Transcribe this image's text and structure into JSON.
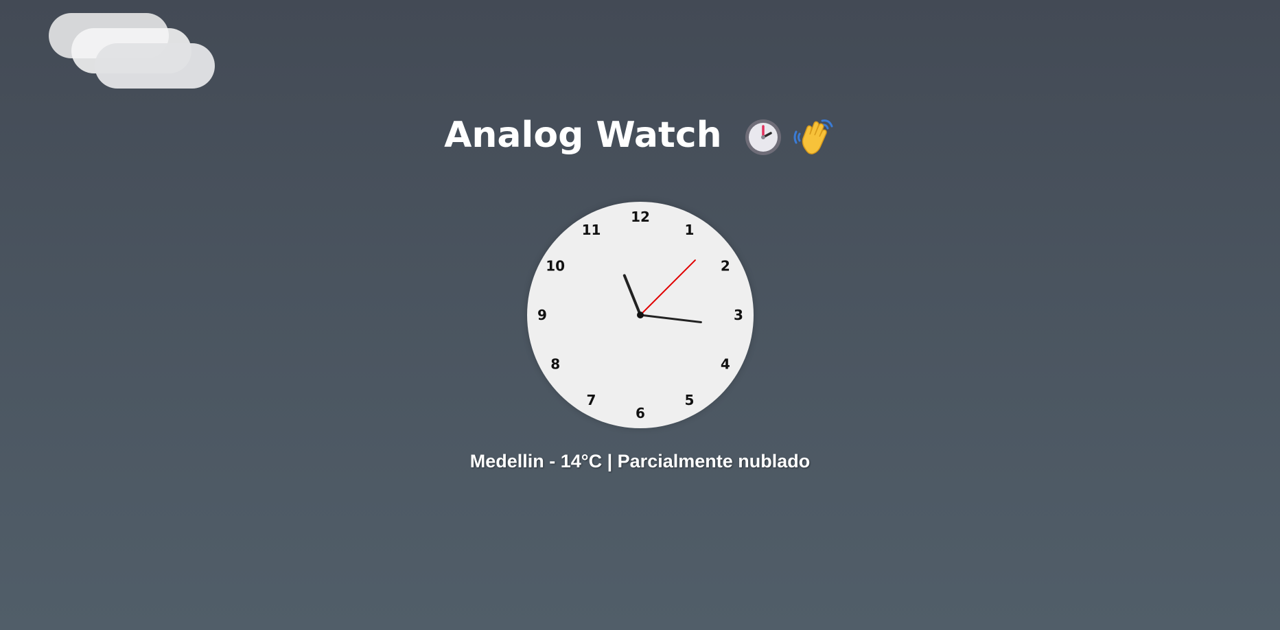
{
  "header": {
    "title": "Analog Watch",
    "icons": [
      "clock-icon",
      "waving-hand-icon"
    ]
  },
  "clock": {
    "numerals": [
      "12",
      "1",
      "2",
      "3",
      "4",
      "5",
      "6",
      "7",
      "8",
      "9",
      "10",
      "11"
    ],
    "time": {
      "hours": 11,
      "minutes": 16,
      "seconds": 7.5
    },
    "colors": {
      "face": "#efefef",
      "hands": "#222222",
      "second_hand": "#e00000"
    }
  },
  "weather": {
    "text": "Medellin - 14°C | Parcialmente nublado"
  },
  "colors": {
    "background_top": "#434a55",
    "background_bottom": "#515e69",
    "text": "#ffffff"
  }
}
